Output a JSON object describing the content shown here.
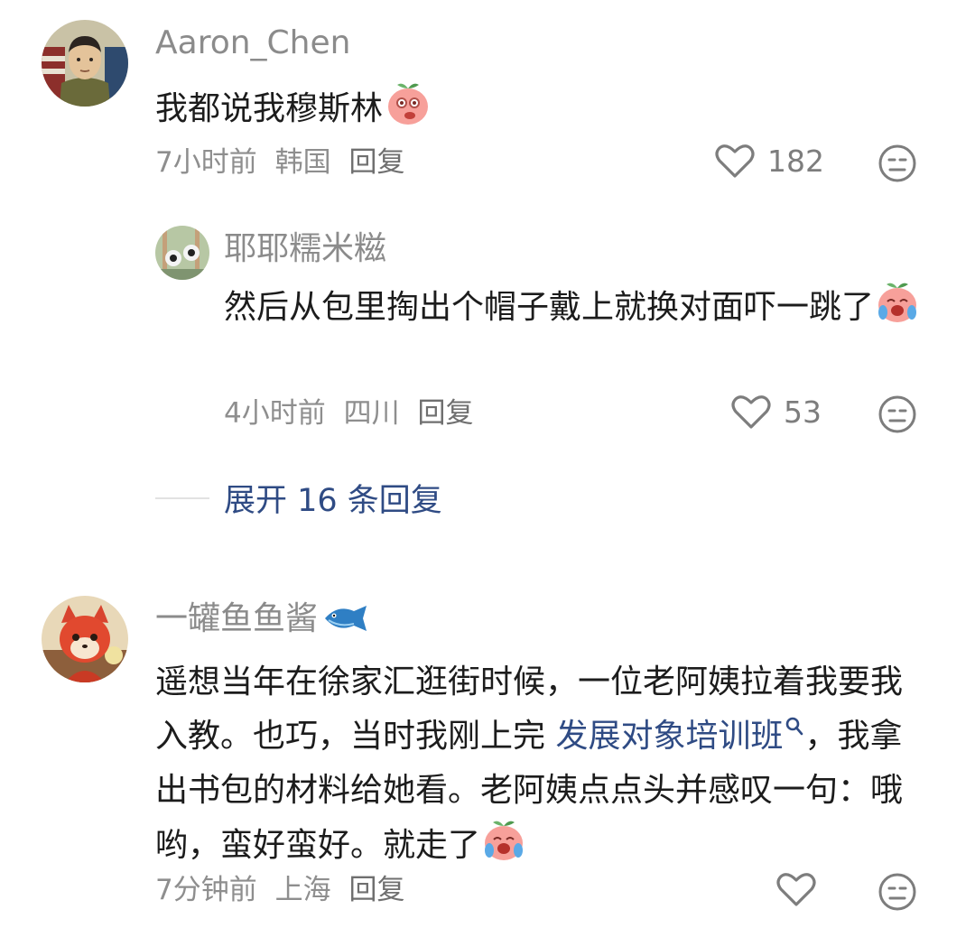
{
  "comments": [
    {
      "username": "Aaron_Chen",
      "text": "我都说我穆斯林",
      "time": "7小时前",
      "location": "韩国",
      "reply_label": "回复",
      "likes": "182"
    },
    {
      "username": "耶耶糯米糍",
      "text": "然后从包里掏出个帽子戴上就换对面吓一跳了",
      "time": "4小时前",
      "location": "四川",
      "reply_label": "回复",
      "likes": "53"
    },
    {
      "username": "一罐鱼鱼酱",
      "text_before_link": "遥想当年在徐家汇逛街时候，一位老阿姨拉着我要我入教。也巧，当时我刚上完",
      "link_text": "发展对象培训班",
      "text_after_link": "，我拿出书包的材料给她看。老阿姨点点头并感叹一句：哦哟，蛮好蛮好。就走了",
      "time": "7分钟前",
      "location": "上海",
      "reply_label": "回复",
      "likes": ""
    }
  ],
  "expand_replies": "展开 16 条回复",
  "colors": {
    "username": "#8b8b8b",
    "body_text": "#1c1c1c",
    "meta": "#8e8e8e",
    "link": "#2f4b84"
  }
}
